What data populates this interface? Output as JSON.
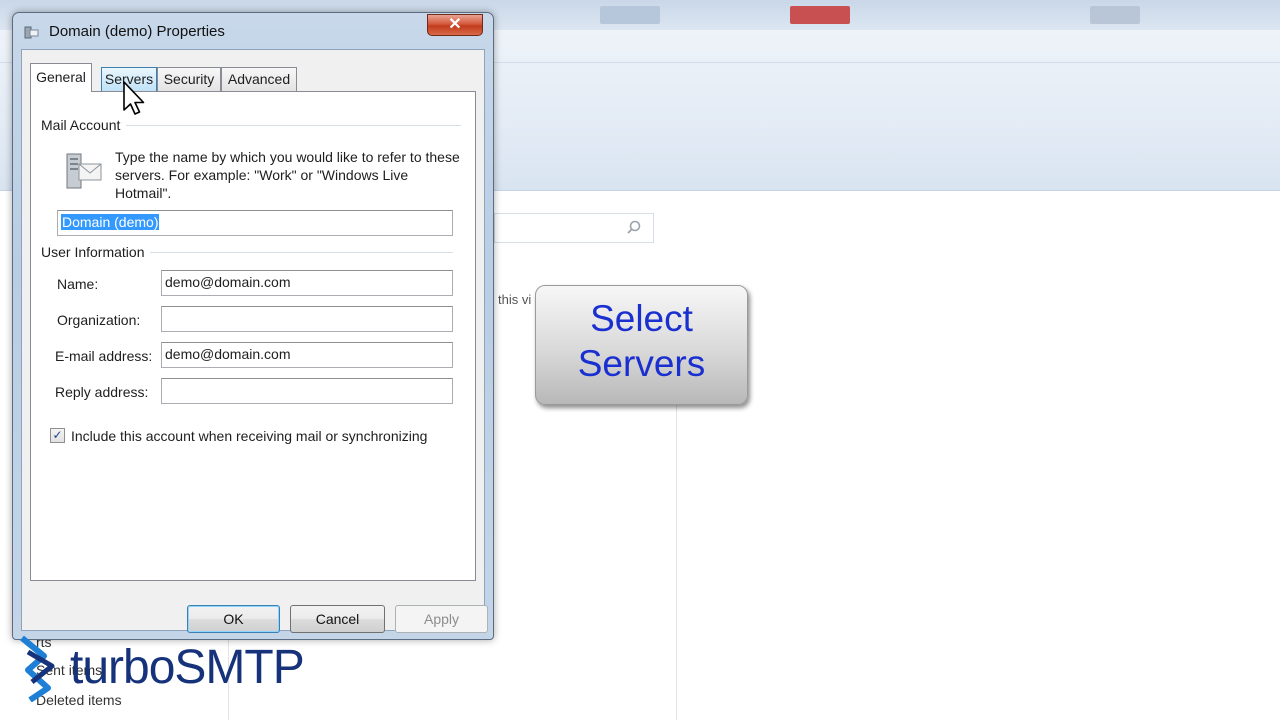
{
  "background": {
    "search_icon": "search-icon",
    "partial_text": "this vi",
    "folders": [
      "rts",
      "Sent items",
      "Deleted items"
    ]
  },
  "dialog": {
    "title": "Domain (demo) Properties",
    "close_glyph": "✕",
    "tabs": [
      "General",
      "Servers",
      "Security",
      "Advanced"
    ],
    "active_tab": "General",
    "hover_tab": "Servers",
    "mail_account": {
      "group_label": "Mail Account",
      "description": "Type the name by which you would like to refer to these servers.  For example: \"Work\" or \"Windows Live Hotmail\".",
      "account_name": "Domain (demo)"
    },
    "user_information": {
      "group_label": "User Information",
      "name_label": "Name:",
      "name_value": "demo@domain.com",
      "organization_label": "Organization:",
      "organization_value": "",
      "email_label": "E-mail address:",
      "email_value": "demo@domain.com",
      "reply_label": "Reply address:",
      "reply_value": ""
    },
    "include_checkbox": {
      "label": "Include this account when receiving mail or synchronizing",
      "checked": true,
      "glyph": "✓"
    },
    "buttons": {
      "ok": "OK",
      "cancel": "Cancel",
      "apply": "Apply"
    }
  },
  "callout": {
    "line1": "Select",
    "line2": "Servers"
  },
  "logo": {
    "text_thin": "turbo",
    "text_bold": "SMTP",
    "color": "#15327a"
  },
  "colors": {
    "callout_text": "#1a2fd0",
    "selection": "#3399ff",
    "close_button": "#c23b1c"
  }
}
